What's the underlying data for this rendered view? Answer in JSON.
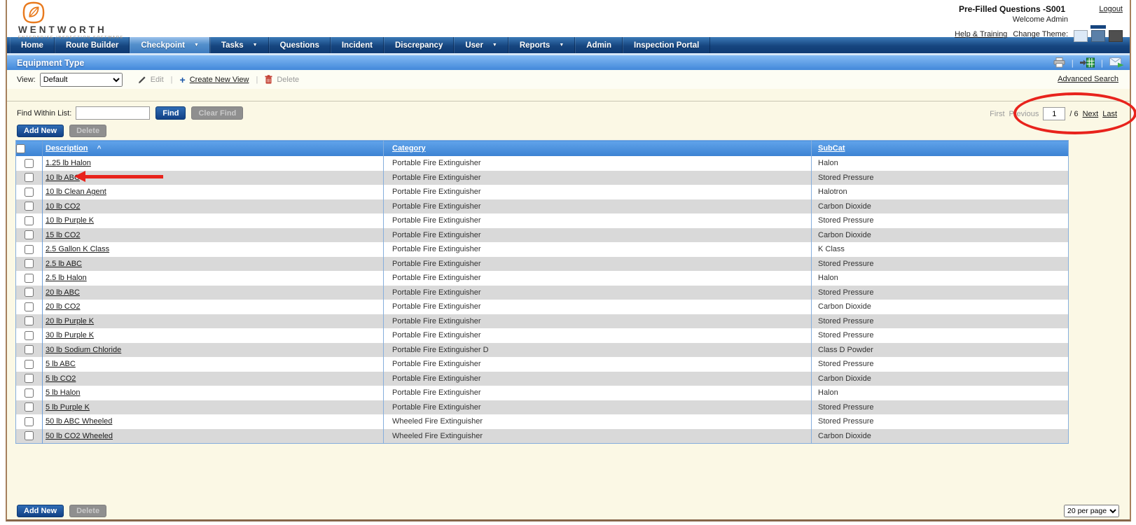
{
  "header": {
    "brand": "WENTWORTH",
    "tagline": "ENTERPRISE INSPECTION SOFTWARE",
    "context_title": "Pre-Filled Questions -S001",
    "welcome": "Welcome Admin",
    "help_link": "Help & Training",
    "change_theme_label": "Change Theme:",
    "logout": "Logout",
    "themes": [
      {
        "name": "light",
        "color": "#dce9f7",
        "selected": false
      },
      {
        "name": "blue",
        "color": "#5b80a8",
        "selected": true
      },
      {
        "name": "dark",
        "color": "#4f4f4f",
        "selected": false
      }
    ]
  },
  "nav": {
    "items": [
      {
        "label": "Home",
        "dropdown": false,
        "active": false
      },
      {
        "label": "Route Builder",
        "dropdown": false,
        "active": false
      },
      {
        "label": "Checkpoint",
        "dropdown": true,
        "active": true
      },
      {
        "label": "Tasks",
        "dropdown": true,
        "active": false
      },
      {
        "label": "Questions",
        "dropdown": false,
        "active": false
      },
      {
        "label": "Incident",
        "dropdown": false,
        "active": false
      },
      {
        "label": "Discrepancy",
        "dropdown": false,
        "active": false
      },
      {
        "label": "User",
        "dropdown": true,
        "active": false
      },
      {
        "label": "Reports",
        "dropdown": true,
        "active": false
      },
      {
        "label": "Admin",
        "dropdown": false,
        "active": false
      },
      {
        "label": "Inspection Portal",
        "dropdown": false,
        "active": false
      }
    ]
  },
  "title_bar": {
    "title": "Equipment Type",
    "icons": [
      "print-icon",
      "export-excel-icon",
      "email-export-icon"
    ]
  },
  "view_bar": {
    "view_label": "View:",
    "view_value": "Default",
    "edit_label": "Edit",
    "plus_glyph": "+",
    "create_new_view_label": "Create New View",
    "delete_label": "Delete",
    "advanced_search_label": "Advanced Search"
  },
  "find_bar": {
    "label": "Find Within List:",
    "input_value": "",
    "find_button": "Find",
    "clear_button": "Clear Find",
    "pagination": {
      "first": "First",
      "previous": "Previous",
      "page": "1",
      "of_total": "/ 6",
      "next": "Next",
      "last": "Last"
    }
  },
  "actions": {
    "add_new": "Add New",
    "delete": "Delete"
  },
  "table": {
    "columns": [
      "Description",
      "Category",
      "SubCat"
    ],
    "sort_indicator": "^",
    "rows": [
      [
        "1.25 lb Halon",
        "Portable Fire Extinguisher",
        "Halon"
      ],
      [
        "10 lb ABC",
        "Portable Fire Extinguisher",
        "Stored Pressure"
      ],
      [
        "10 lb Clean Agent",
        "Portable Fire Extinguisher",
        "Halotron"
      ],
      [
        "10 lb CO2",
        "Portable Fire Extinguisher",
        "Carbon Dioxide"
      ],
      [
        "10 lb Purple K",
        "Portable Fire Extinguisher",
        "Stored Pressure"
      ],
      [
        "15 lb CO2",
        "Portable Fire Extinguisher",
        "Carbon Dioxide"
      ],
      [
        "2.5 Gallon K Class",
        "Portable Fire Extinguisher",
        "K Class"
      ],
      [
        "2.5 lb ABC",
        "Portable Fire Extinguisher",
        "Stored Pressure"
      ],
      [
        "2.5 lb Halon",
        "Portable Fire Extinguisher",
        "Halon"
      ],
      [
        "20 lb ABC",
        "Portable Fire Extinguisher",
        "Stored Pressure"
      ],
      [
        "20 lb CO2",
        "Portable Fire Extinguisher",
        "Carbon Dioxide"
      ],
      [
        "20 lb Purple K",
        "Portable Fire Extinguisher",
        "Stored Pressure"
      ],
      [
        "30 lb Purple K",
        "Portable Fire Extinguisher",
        "Stored Pressure"
      ],
      [
        "30 lb Sodium Chloride",
        "Portable Fire Extinguisher D",
        "Class D Powder"
      ],
      [
        "5 lb ABC",
        "Portable Fire Extinguisher",
        "Stored Pressure"
      ],
      [
        "5 lb CO2",
        "Portable Fire Extinguisher",
        "Carbon Dioxide"
      ],
      [
        "5 lb Halon",
        "Portable Fire Extinguisher",
        "Halon"
      ],
      [
        "5 lb Purple K",
        "Portable Fire Extinguisher",
        "Stored Pressure"
      ],
      [
        "50 lb ABC Wheeled",
        "Wheeled Fire Extinguisher",
        "Stored Pressure"
      ],
      [
        "50 lb CO2 Wheeled",
        "Wheeled Fire Extinguisher",
        "Carbon Dioxide"
      ]
    ]
  },
  "footer": {
    "add_new": "Add New",
    "delete": "Delete",
    "per_page": "20 per page"
  },
  "annotations": {
    "color": "#e8231c",
    "arrow_points_to": "10 lb ABC",
    "circle_around": "pagination"
  }
}
